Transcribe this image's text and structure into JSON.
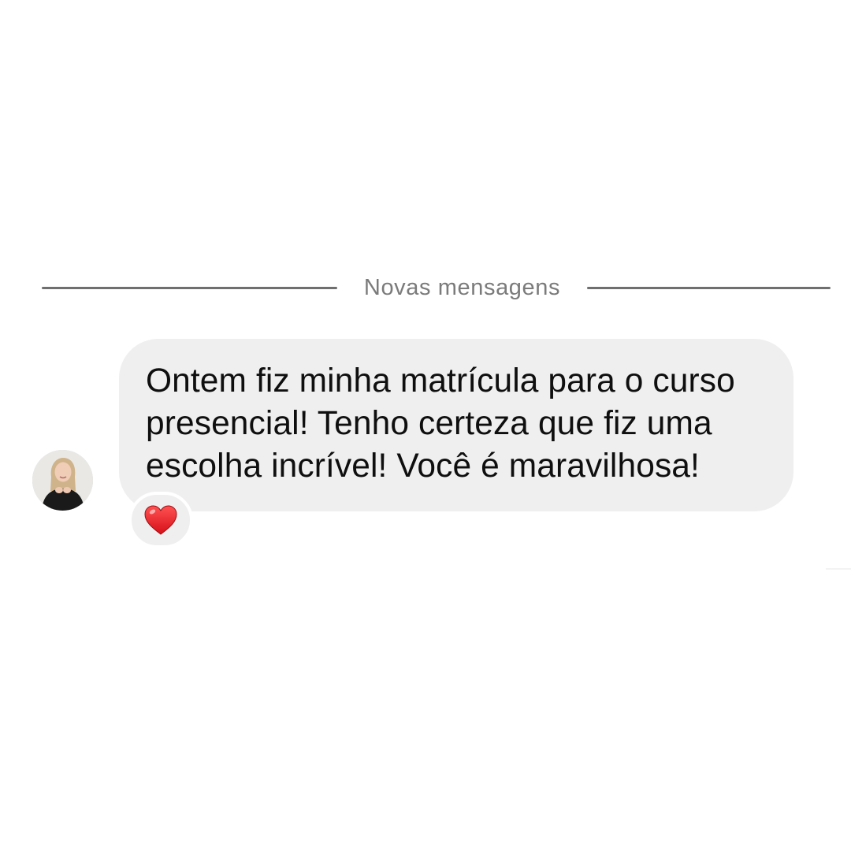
{
  "divider": {
    "label": "Novas mensagens"
  },
  "message": {
    "text": "Ontem fiz minha matrícula para o curso presencial! Tenho certeza que fiz uma escolha incrível! Você é maravilhosa!",
    "bubble_color": "#efefef"
  },
  "reaction": {
    "icon": "red-heart-icon",
    "color": "#e0181f"
  },
  "sender": {
    "avatar_icon": "profile-photo-avatar"
  }
}
